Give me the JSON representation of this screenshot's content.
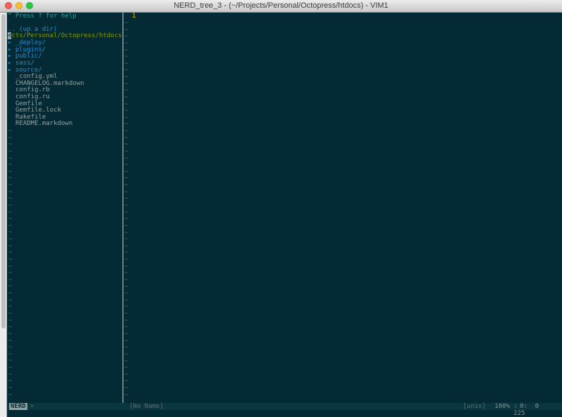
{
  "window": {
    "title": "NERD_tree_3 - (~/Projects/Personal/Octopress/htdocs) - VIM1"
  },
  "tree": {
    "help": "\" Press ? for help",
    "updir": ".. (up a dir)",
    "cursor_char": "<",
    "root_path": "cts/Personal/Octopress/htdocs/",
    "dirs": [
      "_deploy/",
      "plugins/",
      "public/",
      "sass/",
      "source/"
    ],
    "files": [
      "_config.yml",
      "CHANGELOG.markdown",
      "config.rb",
      "config.ru",
      "Gemfile",
      "Gemfile.lock",
      "Rakefile",
      "README.markdown"
    ],
    "arrow_glyph": "▸",
    "filler": "~"
  },
  "editor": {
    "line_number": "1",
    "filler": "~"
  },
  "statusline": {
    "mode": "NERD",
    "arrow": ">",
    "filename": "[No Name]",
    "format": "[unix]",
    "percent": "100% :",
    "position": "0:  0"
  },
  "cmdline": {
    "count": "225"
  },
  "colors": {
    "background": "#042b35",
    "directory": "#268bd2",
    "path": "#859900",
    "help": "#2aa198",
    "file": "#93a1a1",
    "line_number": "#b58900"
  }
}
